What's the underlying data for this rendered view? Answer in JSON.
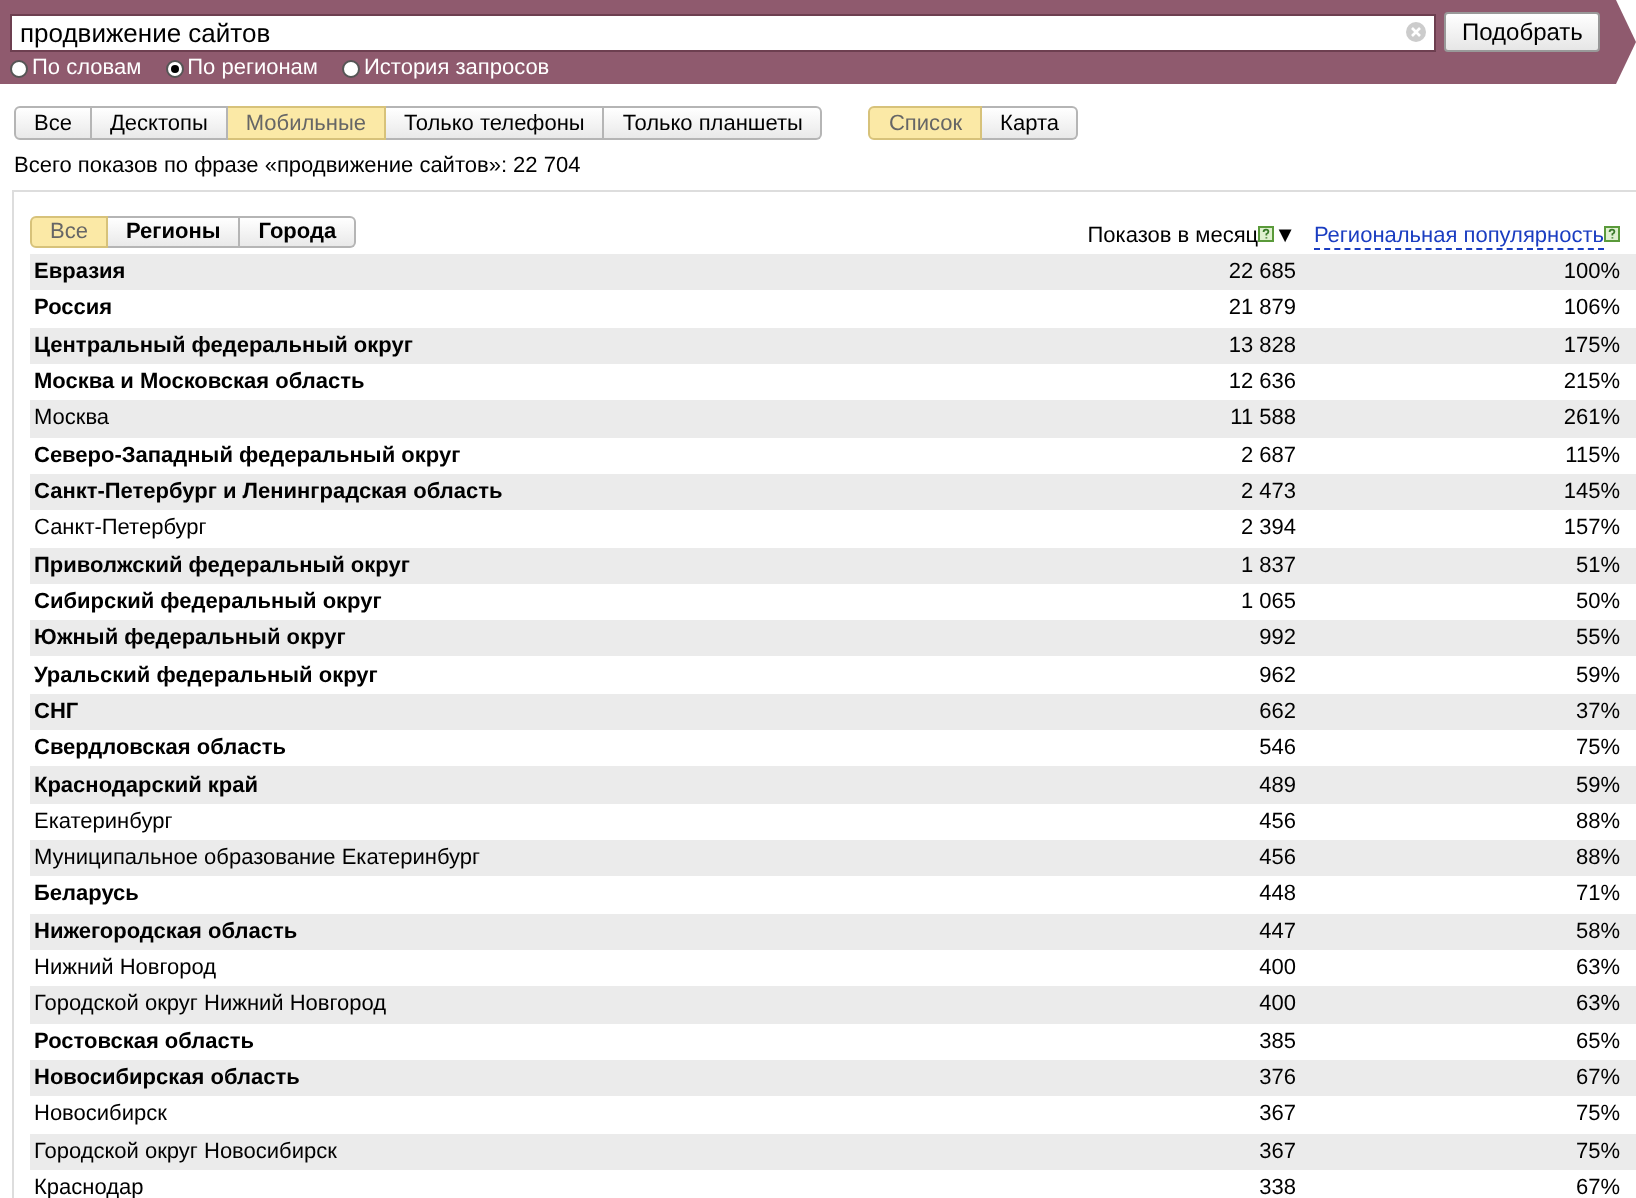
{
  "search": {
    "value": "продвижение сайтов",
    "button": "Подобрать",
    "modes": [
      {
        "label": "По словам",
        "selected": false
      },
      {
        "label": "По регионам",
        "selected": true
      },
      {
        "label": "История запросов",
        "selected": false
      }
    ]
  },
  "device_tabs": [
    {
      "label": "Все",
      "selected": false
    },
    {
      "label": "Десктопы",
      "selected": false
    },
    {
      "label": "Мобильные",
      "selected": true
    },
    {
      "label": "Только телефоны",
      "selected": false
    },
    {
      "label": "Только планшеты",
      "selected": false
    }
  ],
  "view_tabs": [
    {
      "label": "Список",
      "selected": true
    },
    {
      "label": "Карта",
      "selected": false
    }
  ],
  "total": "Всего показов по фразе «продвижение сайтов»: 22 704",
  "region_tabs": [
    {
      "label": "Все",
      "selected": true
    },
    {
      "label": "Регионы",
      "selected": false
    },
    {
      "label": "Города",
      "selected": false
    }
  ],
  "table": {
    "columns": [
      {
        "label": "Показов в месяц",
        "sort_indicator": "▼",
        "link": false
      },
      {
        "label": "Региональная популярность",
        "link": true
      }
    ],
    "rows": [
      {
        "region": "Евразия",
        "bold": true,
        "shows": "22 685",
        "popularity": "100%"
      },
      {
        "region": "Россия",
        "bold": true,
        "shows": "21 879",
        "popularity": "106%"
      },
      {
        "region": "Центральный федеральный округ",
        "bold": true,
        "shows": "13 828",
        "popularity": "175%"
      },
      {
        "region": "Москва и Московская область",
        "bold": true,
        "shows": "12 636",
        "popularity": "215%"
      },
      {
        "region": "Москва",
        "bold": false,
        "shows": "11 588",
        "popularity": "261%"
      },
      {
        "region": "Северо-Западный федеральный округ",
        "bold": true,
        "shows": "2 687",
        "popularity": "115%"
      },
      {
        "region": "Санкт-Петербург и Ленинградская область",
        "bold": true,
        "shows": "2 473",
        "popularity": "145%"
      },
      {
        "region": "Санкт-Петербург",
        "bold": false,
        "shows": "2 394",
        "popularity": "157%"
      },
      {
        "region": "Приволжский федеральный округ",
        "bold": true,
        "shows": "1 837",
        "popularity": "51%"
      },
      {
        "region": "Сибирский федеральный округ",
        "bold": true,
        "shows": "1 065",
        "popularity": "50%"
      },
      {
        "region": "Южный федеральный округ",
        "bold": true,
        "shows": "992",
        "popularity": "55%"
      },
      {
        "region": "Уральский федеральный округ",
        "bold": true,
        "shows": "962",
        "popularity": "59%"
      },
      {
        "region": "СНГ",
        "bold": true,
        "shows": "662",
        "popularity": "37%"
      },
      {
        "region": "Свердловская область",
        "bold": true,
        "shows": "546",
        "popularity": "75%"
      },
      {
        "region": "Краснодарский край",
        "bold": true,
        "shows": "489",
        "popularity": "59%"
      },
      {
        "region": "Екатеринбург",
        "bold": false,
        "shows": "456",
        "popularity": "88%"
      },
      {
        "region": "Муниципальное образование Екатеринбург",
        "bold": false,
        "shows": "456",
        "popularity": "88%"
      },
      {
        "region": "Беларусь",
        "bold": true,
        "shows": "448",
        "popularity": "71%"
      },
      {
        "region": "Нижегородская область",
        "bold": true,
        "shows": "447",
        "popularity": "58%"
      },
      {
        "region": "Нижний Новгород",
        "bold": false,
        "shows": "400",
        "popularity": "63%"
      },
      {
        "region": "Городской округ Нижний Новгород",
        "bold": false,
        "shows": "400",
        "popularity": "63%"
      },
      {
        "region": "Ростовская область",
        "bold": true,
        "shows": "385",
        "popularity": "65%"
      },
      {
        "region": "Новосибирская область",
        "bold": true,
        "shows": "376",
        "popularity": "67%"
      },
      {
        "region": "Новосибирск",
        "bold": false,
        "shows": "367",
        "popularity": "75%"
      },
      {
        "region": "Городской округ Новосибирск",
        "bold": false,
        "shows": "367",
        "popularity": "75%"
      },
      {
        "region": "Краснодар",
        "bold": false,
        "shows": "338",
        "popularity": "67%"
      }
    ]
  }
}
